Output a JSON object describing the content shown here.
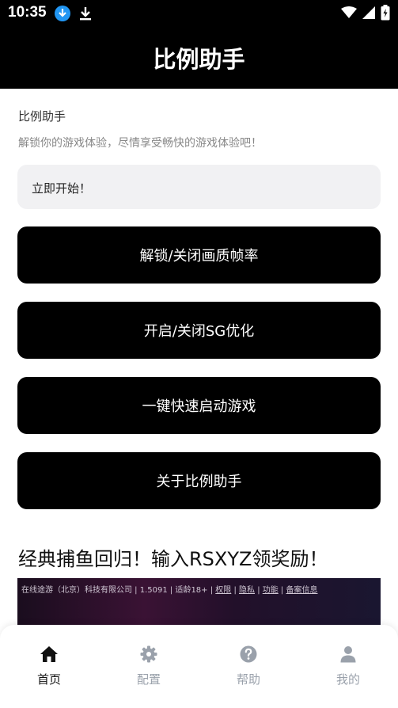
{
  "status_bar": {
    "time": "10:35"
  },
  "app": {
    "title": "比例助手"
  },
  "intro": {
    "title": "比例助手",
    "description": "解锁你的游戏体验，尽情享受畅快的游戏体验吧！"
  },
  "start_field": {
    "text": "立即开始！"
  },
  "buttons": [
    {
      "label": "解锁/关闭画质帧率"
    },
    {
      "label": "开启/关闭SG优化"
    },
    {
      "label": "一键快速启动游戏"
    },
    {
      "label": "关于比例助手"
    }
  ],
  "promo": {
    "text": "经典捕鱼回归！输入RSXYZ领奖励！"
  },
  "banner": {
    "company": "在线途游（北京）科技有限公司 | 1.5091 | 适龄18+ | ",
    "link_permissions": "权限",
    "sep1": " | ",
    "link_privacy": "隐私",
    "sep2": " | ",
    "link_features": "功能",
    "sep3": " | ",
    "link_filing": "备案信息"
  },
  "bottom_nav": [
    {
      "label": "首页",
      "icon": "home-icon",
      "active": true
    },
    {
      "label": "配置",
      "icon": "gear-icon",
      "active": false
    },
    {
      "label": "帮助",
      "icon": "help-icon",
      "active": false
    },
    {
      "label": "我的",
      "icon": "person-icon",
      "active": false
    }
  ],
  "colors": {
    "active": "#111111",
    "inactive": "#9aa1ab",
    "button_bg": "#000000",
    "field_bg": "#f1f1f3"
  }
}
